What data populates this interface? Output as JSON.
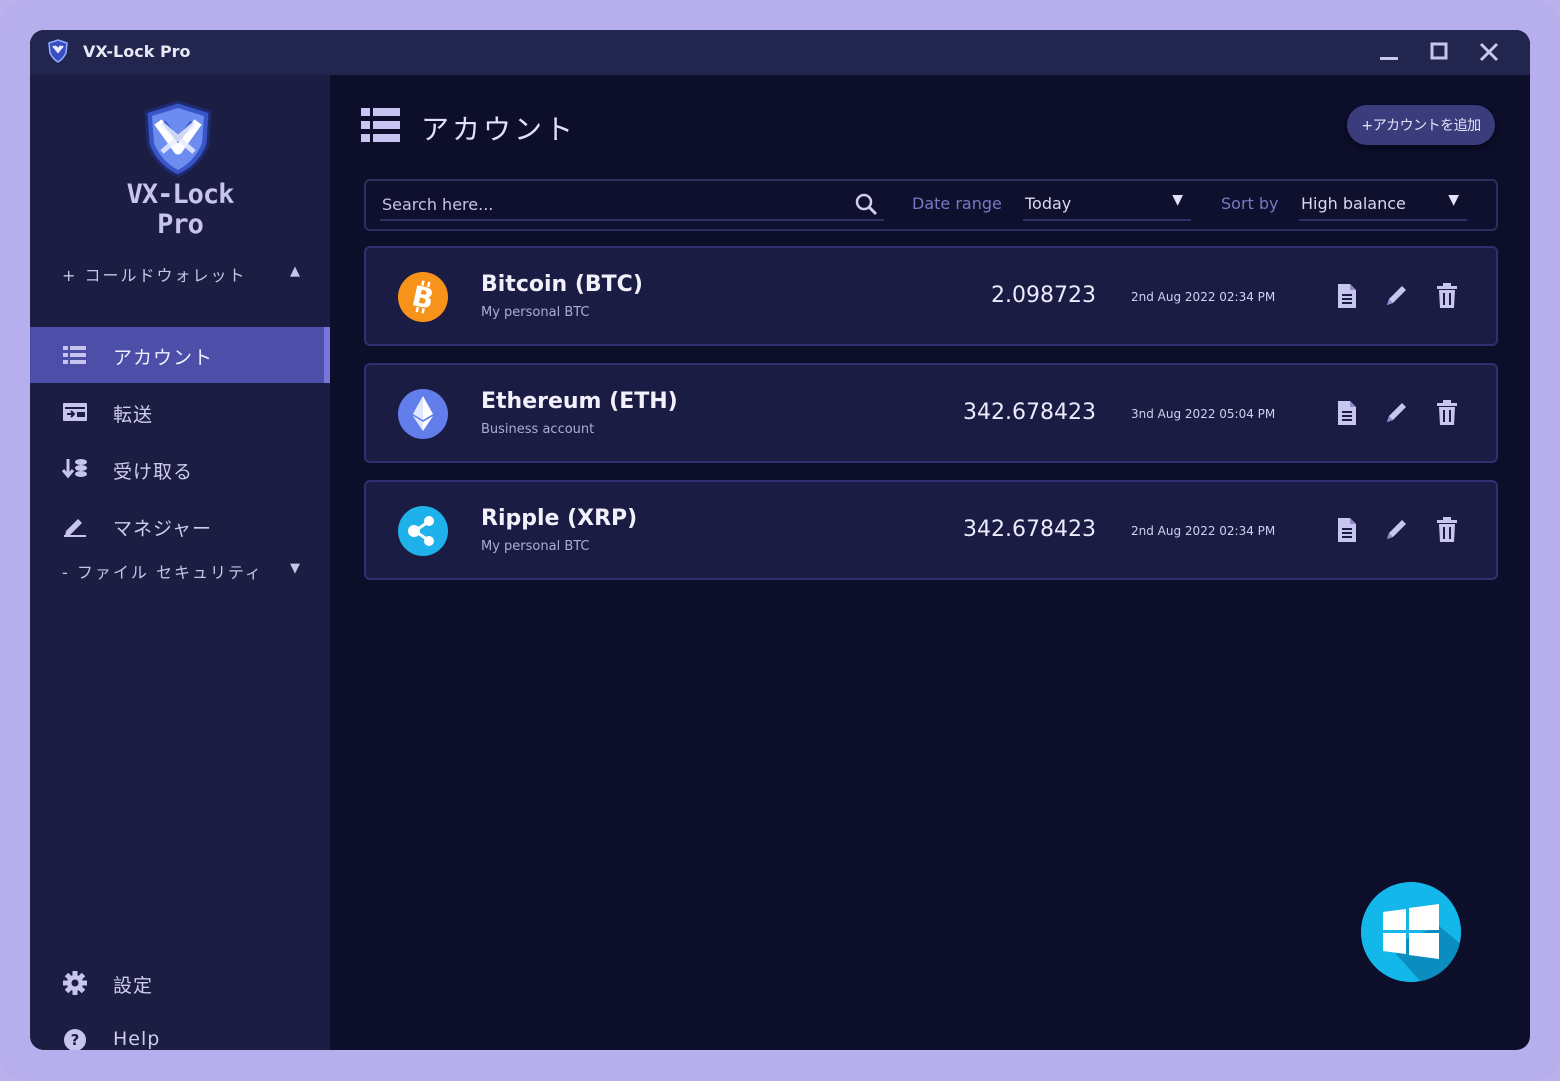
{
  "window": {
    "title": "VX-Lock Pro"
  },
  "brand": {
    "line1": "VX-Lock",
    "line2": "Pro"
  },
  "sidebar": {
    "cold_wallet": {
      "label": "+ コールドウォレット",
      "caret": "▲"
    },
    "items": [
      {
        "label": "アカウント",
        "icon": "list-icon",
        "active": true
      },
      {
        "label": "転送",
        "icon": "transfer-icon",
        "active": false
      },
      {
        "label": "受け取る",
        "icon": "receive-icon",
        "active": false
      },
      {
        "label": "マネジャー",
        "icon": "pencil-icon",
        "active": false
      }
    ],
    "file_security": {
      "label": "- ファイル セキュリティ",
      "caret": "▼"
    },
    "settings": {
      "label": "設定",
      "icon": "gear-icon"
    },
    "help": {
      "label": "Help",
      "icon": "help-icon"
    }
  },
  "main": {
    "title": "アカウント",
    "add_button": "+アカウントを追加",
    "search": {
      "placeholder": "Search here..."
    },
    "date_range": {
      "label": "Date range",
      "value": "Today"
    },
    "sort_by": {
      "label": "Sort by",
      "value": "High balance"
    },
    "accounts": [
      {
        "name": "Bitcoin (BTC)",
        "desc": "My personal BTC",
        "amount": "2.098723",
        "date": "2nd Aug 2022 02:34 PM",
        "icon": "bitcoin-icon",
        "color": "#f7931a"
      },
      {
        "name": "Ethereum (ETH)",
        "desc": "Business account",
        "amount": "342.678423",
        "date": "3nd Aug 2022 05:04 PM",
        "icon": "ethereum-icon",
        "color": "#627eea"
      },
      {
        "name": "Ripple (XRP)",
        "desc": "My personal BTC",
        "amount": "342.678423",
        "date": "2nd Aug 2022 02:34 PM",
        "icon": "ripple-icon",
        "color": "#1fb2ea"
      }
    ]
  },
  "colors": {
    "accent": "#4c4ea8",
    "sidebar": "#1c1d42",
    "background": "#0c0e2a",
    "frame": "#b7aeee"
  }
}
